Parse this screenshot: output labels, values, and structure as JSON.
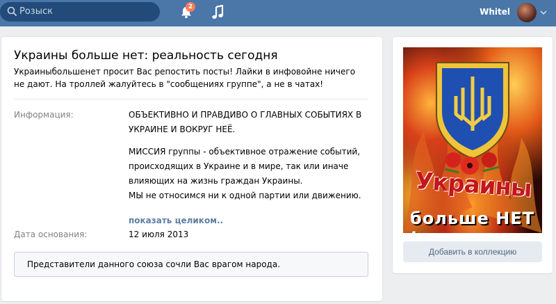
{
  "header": {
    "search_placeholder": "Розыск",
    "notifications_count": "2",
    "username": "Whitel"
  },
  "group": {
    "title": "Украины больше нет: реальность сегодня",
    "status": "Украиныбольшенет просит Вас репостить посты! Лайки в инфовойне ничего не дают. На троллей жалуйтесь в \"сообщениях группе\", а не в чатах!",
    "info_label": "Информация:",
    "info_p1": "ОБЪЕКТИВНО И ПРАВДИВО О ГЛАВНЫХ СОБЫТИЯХ В УКРАИНЕ И ВОКРУГ НЕЁ.",
    "info_p2": "МИССИЯ группы - объективное отражение событий, происходящих в Украине и в мире, так или иначе влияющих на жизнь граждан Украины.",
    "info_p3": "МЫ не относимся ни к одной партии или движению.",
    "show_more": "показать целиком..",
    "founded_label": "Дата основания:",
    "founded_value": "12 июля 2013",
    "notice": "Представители данного союза сочли Вас врагом народа."
  },
  "sidebar": {
    "poster_line1": "Украины",
    "poster_line2": "больше НЕТ !",
    "add_button": "Добавить в коллекцию"
  },
  "colors": {
    "header_bg": "#4a76a8",
    "link": "#5c7fa5",
    "badge": "#ff7a5c",
    "button_bg": "#e5ebf1"
  },
  "icons": {
    "search": "search-icon",
    "notifications": "bell-icon",
    "music": "music-note-icon",
    "avatar_menu": "chevron-down-icon"
  }
}
